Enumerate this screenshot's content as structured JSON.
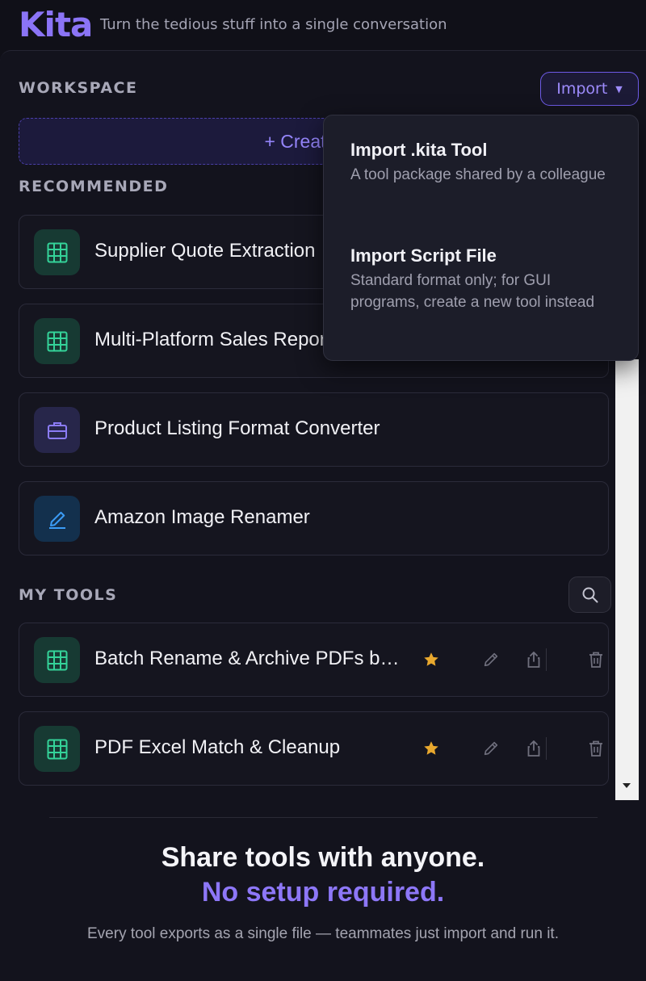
{
  "header": {
    "logo": "Kita",
    "tagline": "Turn the tedious stuff into a single conversation"
  },
  "workspace": {
    "title": "WORKSPACE",
    "import_label": "Import",
    "create_label": "+ Create Au"
  },
  "recommended": {
    "title": "RECOMMENDED",
    "items": [
      {
        "label": "Supplier Quote Extraction",
        "icon": "grid-icon",
        "color": "green"
      },
      {
        "label": "Multi-Platform Sales Repor",
        "icon": "grid-icon",
        "color": "green"
      },
      {
        "label": "Product Listing Format Converter",
        "icon": "briefcase-icon",
        "color": "purple"
      },
      {
        "label": "Amazon Image Renamer",
        "icon": "pencil-icon",
        "color": "blue"
      }
    ]
  },
  "my_tools": {
    "title": "MY TOOLS",
    "items": [
      {
        "label": "Batch Rename & Archive PDFs by Excel List",
        "icon": "grid-icon",
        "favorite": true
      },
      {
        "label": "PDF Excel Match & Cleanup",
        "icon": "grid-icon",
        "favorite": true
      }
    ]
  },
  "import_menu": {
    "items": [
      {
        "title": "Import .kita Tool",
        "description": "A tool package shared by a colleague"
      },
      {
        "title": "Import Script File",
        "description": "Standard format only; for GUI programs, create a new tool instead"
      }
    ]
  },
  "promo": {
    "headline": "Share tools with anyone.",
    "highlight": "No setup required.",
    "subtext": "Every tool exports as a single file — teammates just import and run it."
  },
  "colors": {
    "accent": "#8b74f6",
    "star": "#e8a82e",
    "green_icon": "#34d399",
    "purple_icon": "#8b7cf6",
    "blue_icon": "#3b9cf6"
  }
}
